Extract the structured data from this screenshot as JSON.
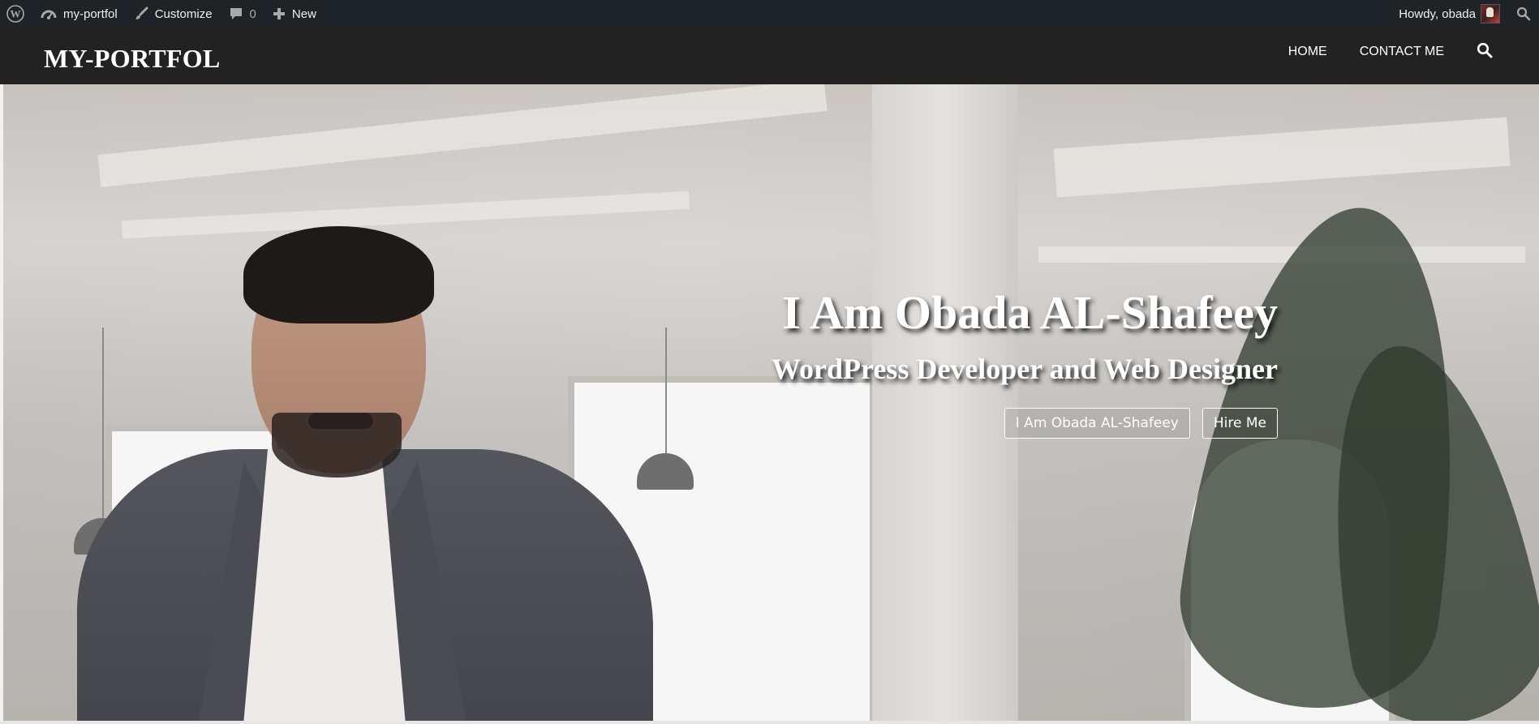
{
  "admin_bar": {
    "site_name": "my-portfol",
    "customize": "Customize",
    "comments_count": "0",
    "new": "New",
    "howdy": "Howdy, obada"
  },
  "header": {
    "site_title": "MY-PORTFOL",
    "nav": [
      {
        "label": "HOME"
      },
      {
        "label": "CONTACT ME"
      }
    ]
  },
  "hero": {
    "title": "I Am Obada AL-Shafeey",
    "subtitle": "WordPress Developer and Web Designer",
    "buttons": [
      {
        "label": "I Am Obada AL-Shafeey"
      },
      {
        "label": "Hire Me"
      }
    ]
  },
  "colors": {
    "admin_bar_bg": "#1d2327",
    "header_bg": "#222222",
    "text_light": "#ffffff"
  },
  "icons": {
    "admin_bar": [
      "wordpress-logo-icon",
      "dashboard-icon",
      "paintbrush-icon",
      "comment-icon",
      "plus-icon",
      "search-icon"
    ],
    "header": [
      "search-icon"
    ]
  }
}
